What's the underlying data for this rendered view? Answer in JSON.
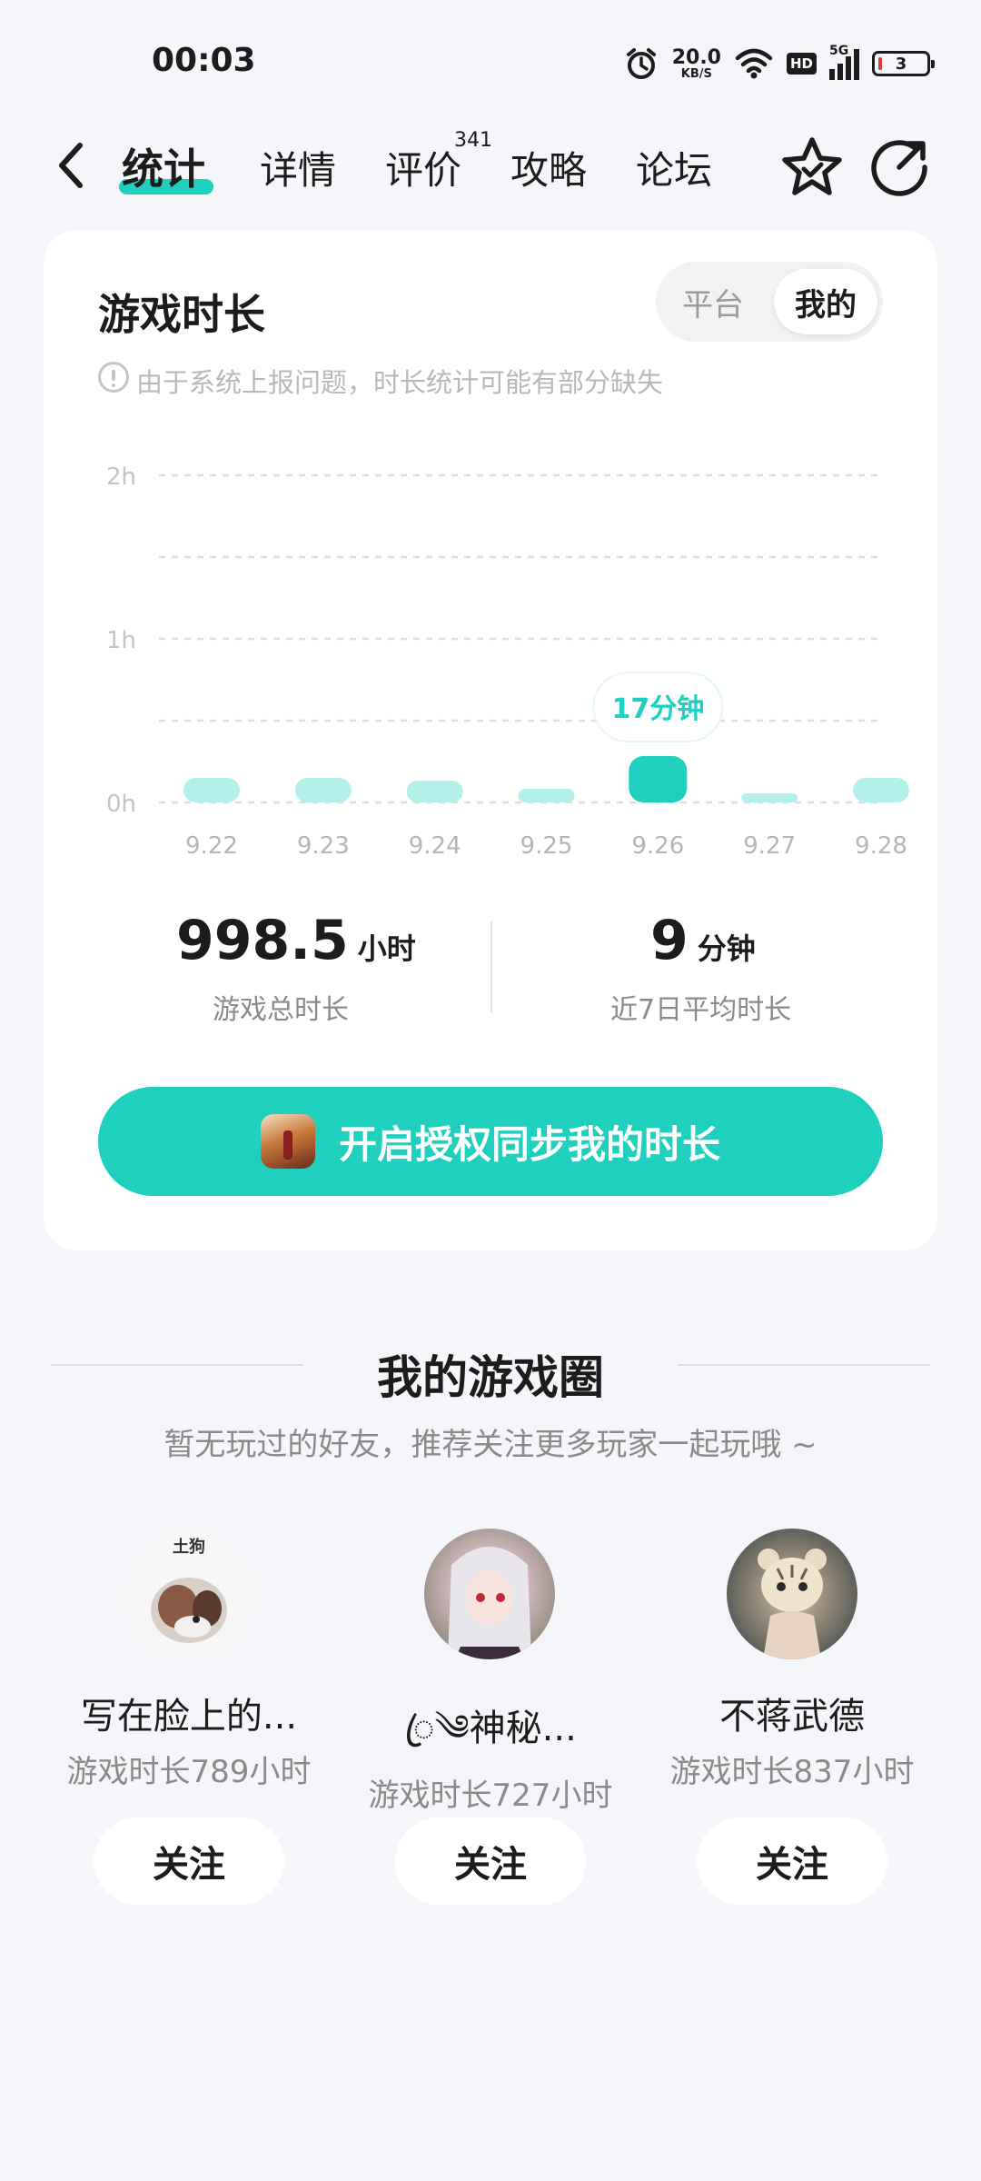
{
  "status_bar": {
    "time": "00:03",
    "net_speed_value": "20.0",
    "net_speed_unit": "KB/S",
    "hd_label": "HD",
    "signal_label": "5G",
    "battery_level": "3"
  },
  "nav": {
    "tabs": [
      {
        "label": "统计",
        "active": true
      },
      {
        "label": "详情"
      },
      {
        "label": "评价",
        "badge": "341"
      },
      {
        "label": "攻略"
      },
      {
        "label": "论坛"
      }
    ]
  },
  "stats_card": {
    "title": "游戏时长",
    "toggle_platform": "平台",
    "toggle_mine": "我的",
    "notice": "由于系统上报问题，时长统计可能有部分缺失",
    "tooltip": "17分钟",
    "total": {
      "value": "998.5",
      "unit": "小时",
      "label": "游戏总时长"
    },
    "average": {
      "value": "9",
      "unit": "分钟",
      "label": "近7日平均时长"
    },
    "sync_button": "开启授权同步我的时长"
  },
  "chart_data": {
    "type": "bar",
    "categories": [
      "9.22",
      "9.23",
      "9.24",
      "9.25",
      "9.26",
      "9.27",
      "9.28"
    ],
    "values": [
      9,
      9,
      8,
      5,
      17,
      3,
      9
    ],
    "ylabel": "",
    "y_ticks": [
      "0h",
      "1h",
      "2h"
    ],
    "ylim": [
      0,
      120
    ],
    "highlight_index": 4,
    "grid": true
  },
  "colors": {
    "accent": "#1ed0bd",
    "accent_light": "#b4f0ea",
    "background": "#f4f6f9"
  },
  "game_circle": {
    "title": "我的游戏圈",
    "subtitle": "暂无玩过的好友，推荐关注更多玩家一起玩哦 ~",
    "users": [
      {
        "avatar_caption": "土狗",
        "name": "写在脸上的...",
        "meta": "游戏时长789小时",
        "follow": "关注"
      },
      {
        "name": "ꦿ༄神秘...",
        "meta": "游戏时长727小时",
        "follow": "关注"
      },
      {
        "name": "不蒋武德",
        "meta": "游戏时长837小时",
        "follow": "关注"
      }
    ]
  }
}
